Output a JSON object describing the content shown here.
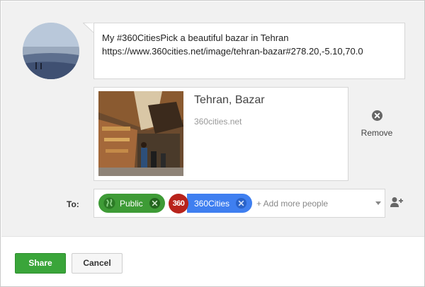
{
  "composer": {
    "message_line1": "My #360CitiesPick a beautiful bazar in Tehran",
    "message_line2": "https://www.360cities.net/image/tehran-bazar#278.20,-5.10,70.0"
  },
  "link_preview": {
    "title": "Tehran, Bazar",
    "domain": "360cities.net",
    "remove_label": "Remove"
  },
  "audience": {
    "to_label": "To:",
    "chips": [
      {
        "label": "Public",
        "color": "#3e9b36",
        "icon": "globe-icon"
      },
      {
        "label": "360Cities",
        "badge": "360",
        "color": "#3f7ff0",
        "badge_color": "#b8231b"
      }
    ],
    "placeholder": "+ Add more people"
  },
  "actions": {
    "share_label": "Share",
    "cancel_label": "Cancel",
    "share_color": "#3aa53a"
  },
  "icons": {
    "remove": "close-circle-icon",
    "add_person": "add-person-icon",
    "dropdown": "chevron-down-icon"
  }
}
